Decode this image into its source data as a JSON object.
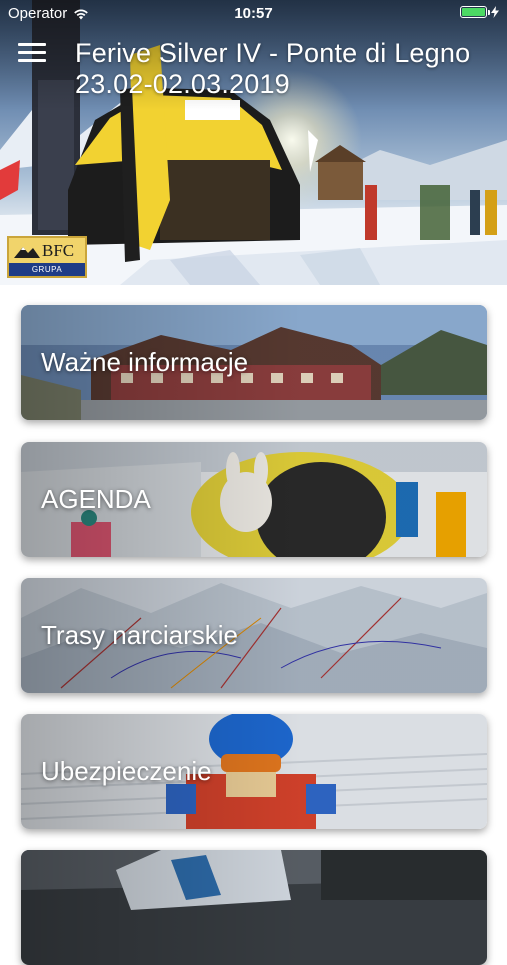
{
  "status_bar": {
    "carrier": "Operator",
    "time": "10:57",
    "icons": [
      "wifi-icon",
      "battery-icon",
      "charging-bolt-icon"
    ],
    "battery_color": "#4cd964"
  },
  "header": {
    "title": "Ferive Silver IV - Ponte di Legno 23.02-02.03.2019",
    "menu_icon": "hamburger-menu-icon"
  },
  "logo": {
    "text": "BFC",
    "subtext": "GRUPA",
    "colors": {
      "background": "#f1d46b",
      "band": "#1f3c86"
    }
  },
  "menu_cards": [
    {
      "label": "Ważne informacje",
      "image": "hotel-photo"
    },
    {
      "label": "AGENDA",
      "image": "ski-school-photo"
    },
    {
      "label": "Trasy narciarskie",
      "image": "ski-map-photo"
    },
    {
      "label": "Ubezpieczenie",
      "image": "child-skier-photo"
    },
    {
      "label": "",
      "image": "ski-sign-photo"
    }
  ]
}
